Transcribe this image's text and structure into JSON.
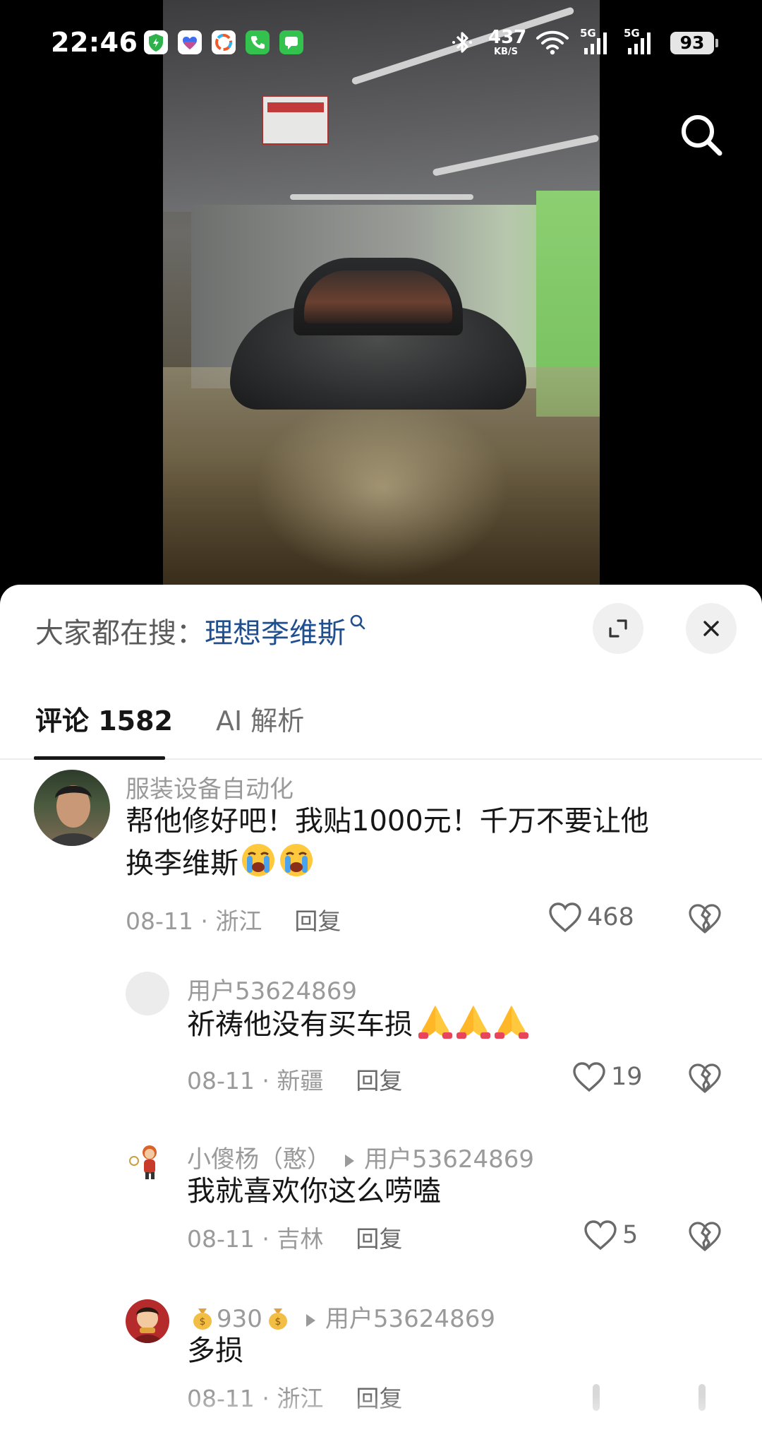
{
  "status_bar": {
    "time": "22:46",
    "net_speed": "437",
    "net_unit": "KB/S",
    "signal_1": "5G",
    "signal_2": "5G",
    "battery": "93"
  },
  "sheet": {
    "hot_search_prefix": "大家都在搜：",
    "hot_search_keyword": "理想李维斯"
  },
  "tabs": {
    "comments": "评论 1582",
    "ai": "AI 解析"
  },
  "comments": [
    {
      "user": "服装设备自动化",
      "text_line1": "帮他修好吧！我贴1000元！千万不要让他",
      "text_line2": "换李维斯",
      "date_location": "08-11 · 浙江",
      "reply": "回复",
      "likes": "468"
    },
    {
      "user": "用户53624869",
      "text": "祈祷他没有买车损",
      "date_location": "08-11 · 新疆",
      "reply": "回复",
      "likes": "19"
    },
    {
      "user": "小傻杨（憨）",
      "reply_to": "用户53624869",
      "text": "我就喜欢你这么唠嗑",
      "date_location": "08-11 · 吉林",
      "reply": "回复",
      "likes": "5"
    },
    {
      "user": "930",
      "reply_to": "用户53624869",
      "text": "多损",
      "date_location": "08-11 · 浙江",
      "reply": "回复"
    }
  ],
  "icons": {
    "top_right": "search-icon",
    "sheet_expand": "expand-icon",
    "sheet_close": "close-icon",
    "like": "heart-icon",
    "dislike": "broken-heart-icon",
    "emoji_crying": "loudly-crying-face-emoji",
    "emoji_pray": "folded-hands-emoji",
    "emoji_money": "money-bag-emoji"
  },
  "colors": {
    "keyword_link": "#1f4f8f",
    "text_primary": "#161616",
    "text_secondary": "#9a9a9a"
  }
}
